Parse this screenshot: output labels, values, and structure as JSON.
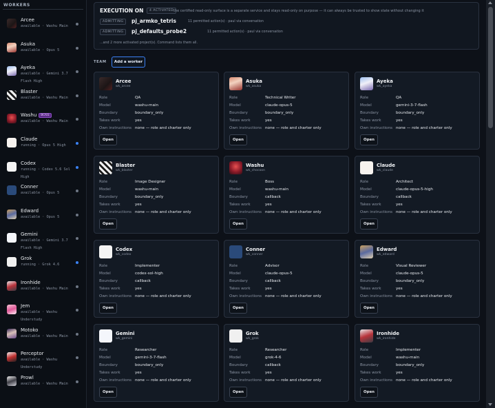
{
  "sidebar": {
    "heading": "WORKERS",
    "items": [
      {
        "name": "Arcee",
        "sub": "available · Washu Main",
        "active": false,
        "boss": false,
        "avatar": "av-arcee",
        "icon": "arcee-avatar-icon"
      },
      {
        "name": "Asuka",
        "sub": "available · Opus 5",
        "active": false,
        "boss": false,
        "avatar": "av-asuka",
        "icon": "asuka-avatar-icon"
      },
      {
        "name": "Ayeka",
        "sub": "available · Gemini 3.7 Flash High",
        "active": false,
        "boss": false,
        "avatar": "av-ayeka",
        "icon": "ayeka-avatar-icon"
      },
      {
        "name": "Blaster",
        "sub": "available · Washu Main",
        "active": false,
        "boss": false,
        "avatar": "av-blaster",
        "icon": "blaster-avatar-icon"
      },
      {
        "name": "Washu",
        "sub": "available · Washu Main",
        "active": false,
        "boss": true,
        "boss_label": "BOSS",
        "avatar": "av-washu",
        "icon": "washu-avatar-icon"
      },
      {
        "name": "Claude",
        "sub": "running · Opus 5 High",
        "active": true,
        "boss": false,
        "avatar": "av-claude",
        "icon": "claude-logo-icon"
      },
      {
        "name": "Codex",
        "sub": "running · Codex 5.6 Sol High",
        "active": true,
        "boss": false,
        "avatar": "av-codex",
        "icon": "codex-logo-icon"
      },
      {
        "name": "Conner",
        "sub": "available · Opus 5",
        "active": false,
        "boss": false,
        "avatar": "av-conner",
        "icon": "conner-logo-icon"
      },
      {
        "name": "Edward",
        "sub": "available · Opus 5",
        "active": false,
        "boss": false,
        "avatar": "av-edward",
        "icon": "edward-avatar-icon"
      },
      {
        "name": "Gemini",
        "sub": "available · Gemini 3.7 Flash High",
        "active": false,
        "boss": false,
        "avatar": "av-gemini",
        "icon": "gemini-logo-icon"
      },
      {
        "name": "Grok",
        "sub": "running · Grok 4.6",
        "active": true,
        "boss": false,
        "avatar": "av-grok",
        "icon": "grok-logo-icon"
      },
      {
        "name": "Ironhide",
        "sub": "available · Washu Main",
        "active": false,
        "boss": false,
        "avatar": "av-ironhide",
        "icon": "ironhide-avatar-icon"
      },
      {
        "name": "Jem",
        "sub": "available · Washu Understudy",
        "active": false,
        "boss": false,
        "avatar": "av-jem",
        "icon": "jem-avatar-icon"
      },
      {
        "name": "Motoko",
        "sub": "available · Washu Main",
        "active": false,
        "boss": false,
        "avatar": "av-motoko",
        "icon": "motoko-avatar-icon"
      },
      {
        "name": "Perceptor",
        "sub": "available · Washu Understudy",
        "active": false,
        "boss": false,
        "avatar": "av-perceptor",
        "icon": "perceptor-avatar-icon"
      },
      {
        "name": "Prowl",
        "sub": "available · Washu Main",
        "active": false,
        "boss": false,
        "avatar": "av-prowl",
        "icon": "prowl-avatar-icon"
      }
    ]
  },
  "execution": {
    "title": "EXECUTION ON",
    "status_pill": "4 ACTIVATED",
    "note": "the certified read-only surface is a separate service and stays read-only on purpose — it can always be trusted to show state without changing it",
    "projects": [
      {
        "pill": "ADMITTING",
        "name": "pj_armko_tetris",
        "meta": "11 permitted action(s) · paul via conversation"
      },
      {
        "pill": "ADMITTING",
        "name": "pj_defaults_probe2",
        "meta": "11 permitted action(s) · paul via conversation"
      }
    ],
    "more": "...and 2 more activated project(s). Command lists them all."
  },
  "team": {
    "label": "TEAM",
    "add_button": "Add a worker",
    "field_labels": {
      "role": "Role",
      "model": "Model",
      "boundary": "Boundary",
      "takes_work": "Takes work",
      "own_instructions": "Own instructions"
    },
    "open_label": "Open",
    "cards": [
      {
        "name": "Arcee",
        "id": "wk_arcee",
        "role": "QA",
        "model": "washu-main",
        "boundary": "boundary_only",
        "takes_work": "yes",
        "instructions": "none — role and charter only",
        "avatar": "av-arcee",
        "icon": "arcee-avatar-icon"
      },
      {
        "name": "Asuka",
        "id": "wk_asuka",
        "role": "Technical Writer",
        "model": "claude-opus-5",
        "boundary": "boundary_only",
        "takes_work": "yes",
        "instructions": "none — role and charter only",
        "avatar": "av-asuka",
        "icon": "asuka-avatar-icon"
      },
      {
        "name": "Ayeka",
        "id": "wk_ayeka",
        "role": "QA",
        "model": "gemini-3-7-flash",
        "boundary": "boundary_only",
        "takes_work": "yes",
        "instructions": "none — role and charter only",
        "avatar": "av-ayeka",
        "icon": "ayeka-avatar-icon"
      },
      {
        "name": "Blaster",
        "id": "wk_blaster",
        "role": "Image Designer",
        "model": "washu-main",
        "boundary": "boundary_only",
        "takes_work": "yes",
        "instructions": "none — role and charter only",
        "avatar": "av-blaster",
        "icon": "blaster-avatar-icon"
      },
      {
        "name": "Washu",
        "id": "wk_chocoon",
        "role": "Boss",
        "model": "washu-main",
        "boundary": "callback",
        "takes_work": "yes",
        "instructions": "none — role and charter only",
        "avatar": "av-washu",
        "icon": "washu-avatar-icon"
      },
      {
        "name": "Claude",
        "id": "wk_claude",
        "role": "Architect",
        "model": "claude-opus-5-high",
        "boundary": "callback",
        "takes_work": "yes",
        "instructions": "none — role and charter only",
        "avatar": "av-claude",
        "icon": "claude-logo-icon"
      },
      {
        "name": "Codex",
        "id": "wk_codex",
        "role": "Implementer",
        "model": "codex-sol-high",
        "boundary": "callback",
        "takes_work": "yes",
        "instructions": "none — role and charter only",
        "avatar": "av-codex",
        "icon": "codex-logo-icon"
      },
      {
        "name": "Conner",
        "id": "wk_conner",
        "role": "Advisor",
        "model": "claude-opus-5",
        "boundary": "callback",
        "takes_work": "yes",
        "instructions": "none — role and charter only",
        "avatar": "av-conner",
        "icon": "conner-logo-icon"
      },
      {
        "name": "Edward",
        "id": "wk_edward",
        "role": "Visual Reviewer",
        "model": "claude-opus-5",
        "boundary": "boundary_only",
        "takes_work": "yes",
        "instructions": "none — role and charter only",
        "avatar": "av-edward",
        "icon": "edward-avatar-icon"
      },
      {
        "name": "Gemini",
        "id": "wk_gemini",
        "role": "Researcher",
        "model": "gemini-3-7-flash",
        "boundary": "boundary_only",
        "takes_work": "yes",
        "instructions": "none — role and charter only",
        "avatar": "av-gemini",
        "icon": "gemini-logo-icon"
      },
      {
        "name": "Grok",
        "id": "wk_grok",
        "role": "Researcher",
        "model": "grok-4-6",
        "boundary": "callback",
        "takes_work": "yes",
        "instructions": "none — role and charter only",
        "avatar": "av-grok",
        "icon": "grok-logo-icon"
      },
      {
        "name": "Ironhide",
        "id": "wk_ironhide",
        "role": "Implementer",
        "model": "washu-main",
        "boundary": "boundary_only",
        "takes_work": "yes",
        "instructions": "none — role and charter only",
        "avatar": "av-ironhide",
        "icon": "ironhide-avatar-icon"
      }
    ]
  },
  "colors": {
    "accent": "#3b82f6",
    "background": "#0d1118",
    "card": "#131a24",
    "boss_badge": "#5b2a86"
  }
}
